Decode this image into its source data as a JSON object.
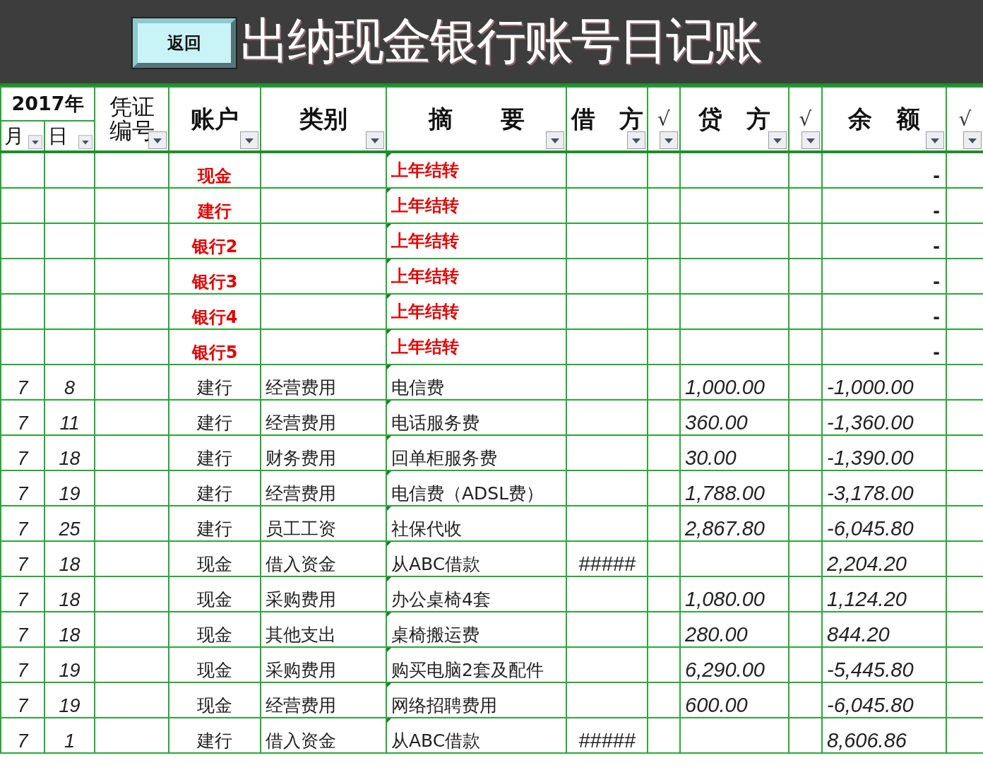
{
  "title": "出纳现金银行账号日记账",
  "back_button": "返回",
  "header": {
    "year": "2017年",
    "month": "月",
    "day": "日",
    "columns": [
      "凭证编号",
      "账户",
      "类别",
      "摘　　要",
      "借　方",
      "√",
      "贷　方",
      "√",
      "余　额",
      "√"
    ]
  },
  "rows": [
    {
      "kind": "carryover",
      "account": "现金",
      "summary": "上年结转",
      "balance": "-"
    },
    {
      "kind": "carryover",
      "account": "建行",
      "summary": "上年结转",
      "balance": "-"
    },
    {
      "kind": "carryover",
      "account": "银行2",
      "summary": "上年结转",
      "balance": "-"
    },
    {
      "kind": "carryover",
      "account": "银行3",
      "summary": "上年结转",
      "balance": "-"
    },
    {
      "kind": "carryover",
      "account": "银行4",
      "summary": "上年结转",
      "balance": "-"
    },
    {
      "kind": "carryover",
      "account": "银行5",
      "summary": "上年结转",
      "balance": "-"
    },
    {
      "kind": "entry",
      "month": "7",
      "day": "8",
      "account": "建行",
      "category": "经营费用",
      "summary": "电信费",
      "credit": "1,000.00",
      "balance": "-1,000.00"
    },
    {
      "kind": "entry",
      "month": "7",
      "day": "11",
      "account": "建行",
      "category": "经营费用",
      "summary": "电话服务费",
      "credit": "360.00",
      "balance": "-1,360.00"
    },
    {
      "kind": "entry",
      "month": "7",
      "day": "18",
      "account": "建行",
      "category": "财务费用",
      "summary": "回单柜服务费",
      "credit": "30.00",
      "balance": "-1,390.00"
    },
    {
      "kind": "entry",
      "month": "7",
      "day": "19",
      "account": "建行",
      "category": "经营费用",
      "summary": "电信费（ADSL费）",
      "credit": "1,788.00",
      "balance": "-3,178.00"
    },
    {
      "kind": "entry",
      "month": "7",
      "day": "25",
      "account": "建行",
      "category": "员工工资",
      "summary": "社保代收",
      "credit": "2,867.80",
      "balance": "-6,045.80"
    },
    {
      "kind": "entry",
      "month": "7",
      "day": "18",
      "account": "现金",
      "category": "借入资金",
      "summary": "从ABC借款",
      "debit": "#####",
      "balance": "2,204.20"
    },
    {
      "kind": "entry",
      "month": "7",
      "day": "18",
      "account": "现金",
      "category": "采购费用",
      "summary": "办公桌椅4套",
      "credit": "1,080.00",
      "balance": "1,124.20"
    },
    {
      "kind": "entry",
      "month": "7",
      "day": "18",
      "account": "现金",
      "category": "其他支出",
      "summary": "桌椅搬运费",
      "credit": "280.00",
      "balance": "844.20"
    },
    {
      "kind": "entry",
      "month": "7",
      "day": "19",
      "account": "现金",
      "category": "采购费用",
      "summary": "购买电脑2套及配件",
      "credit": "6,290.00",
      "balance": "-5,445.80"
    },
    {
      "kind": "entry",
      "month": "7",
      "day": "19",
      "account": "现金",
      "category": "经营费用",
      "summary": "网络招聘费用",
      "credit": "600.00",
      "balance": "-6,045.80"
    },
    {
      "kind": "entry",
      "month": "7",
      "day": "1",
      "account": "建行",
      "category": "借入资金",
      "summary": "从ABC借款",
      "debit": "#####",
      "balance": "8,606.86"
    }
  ]
}
